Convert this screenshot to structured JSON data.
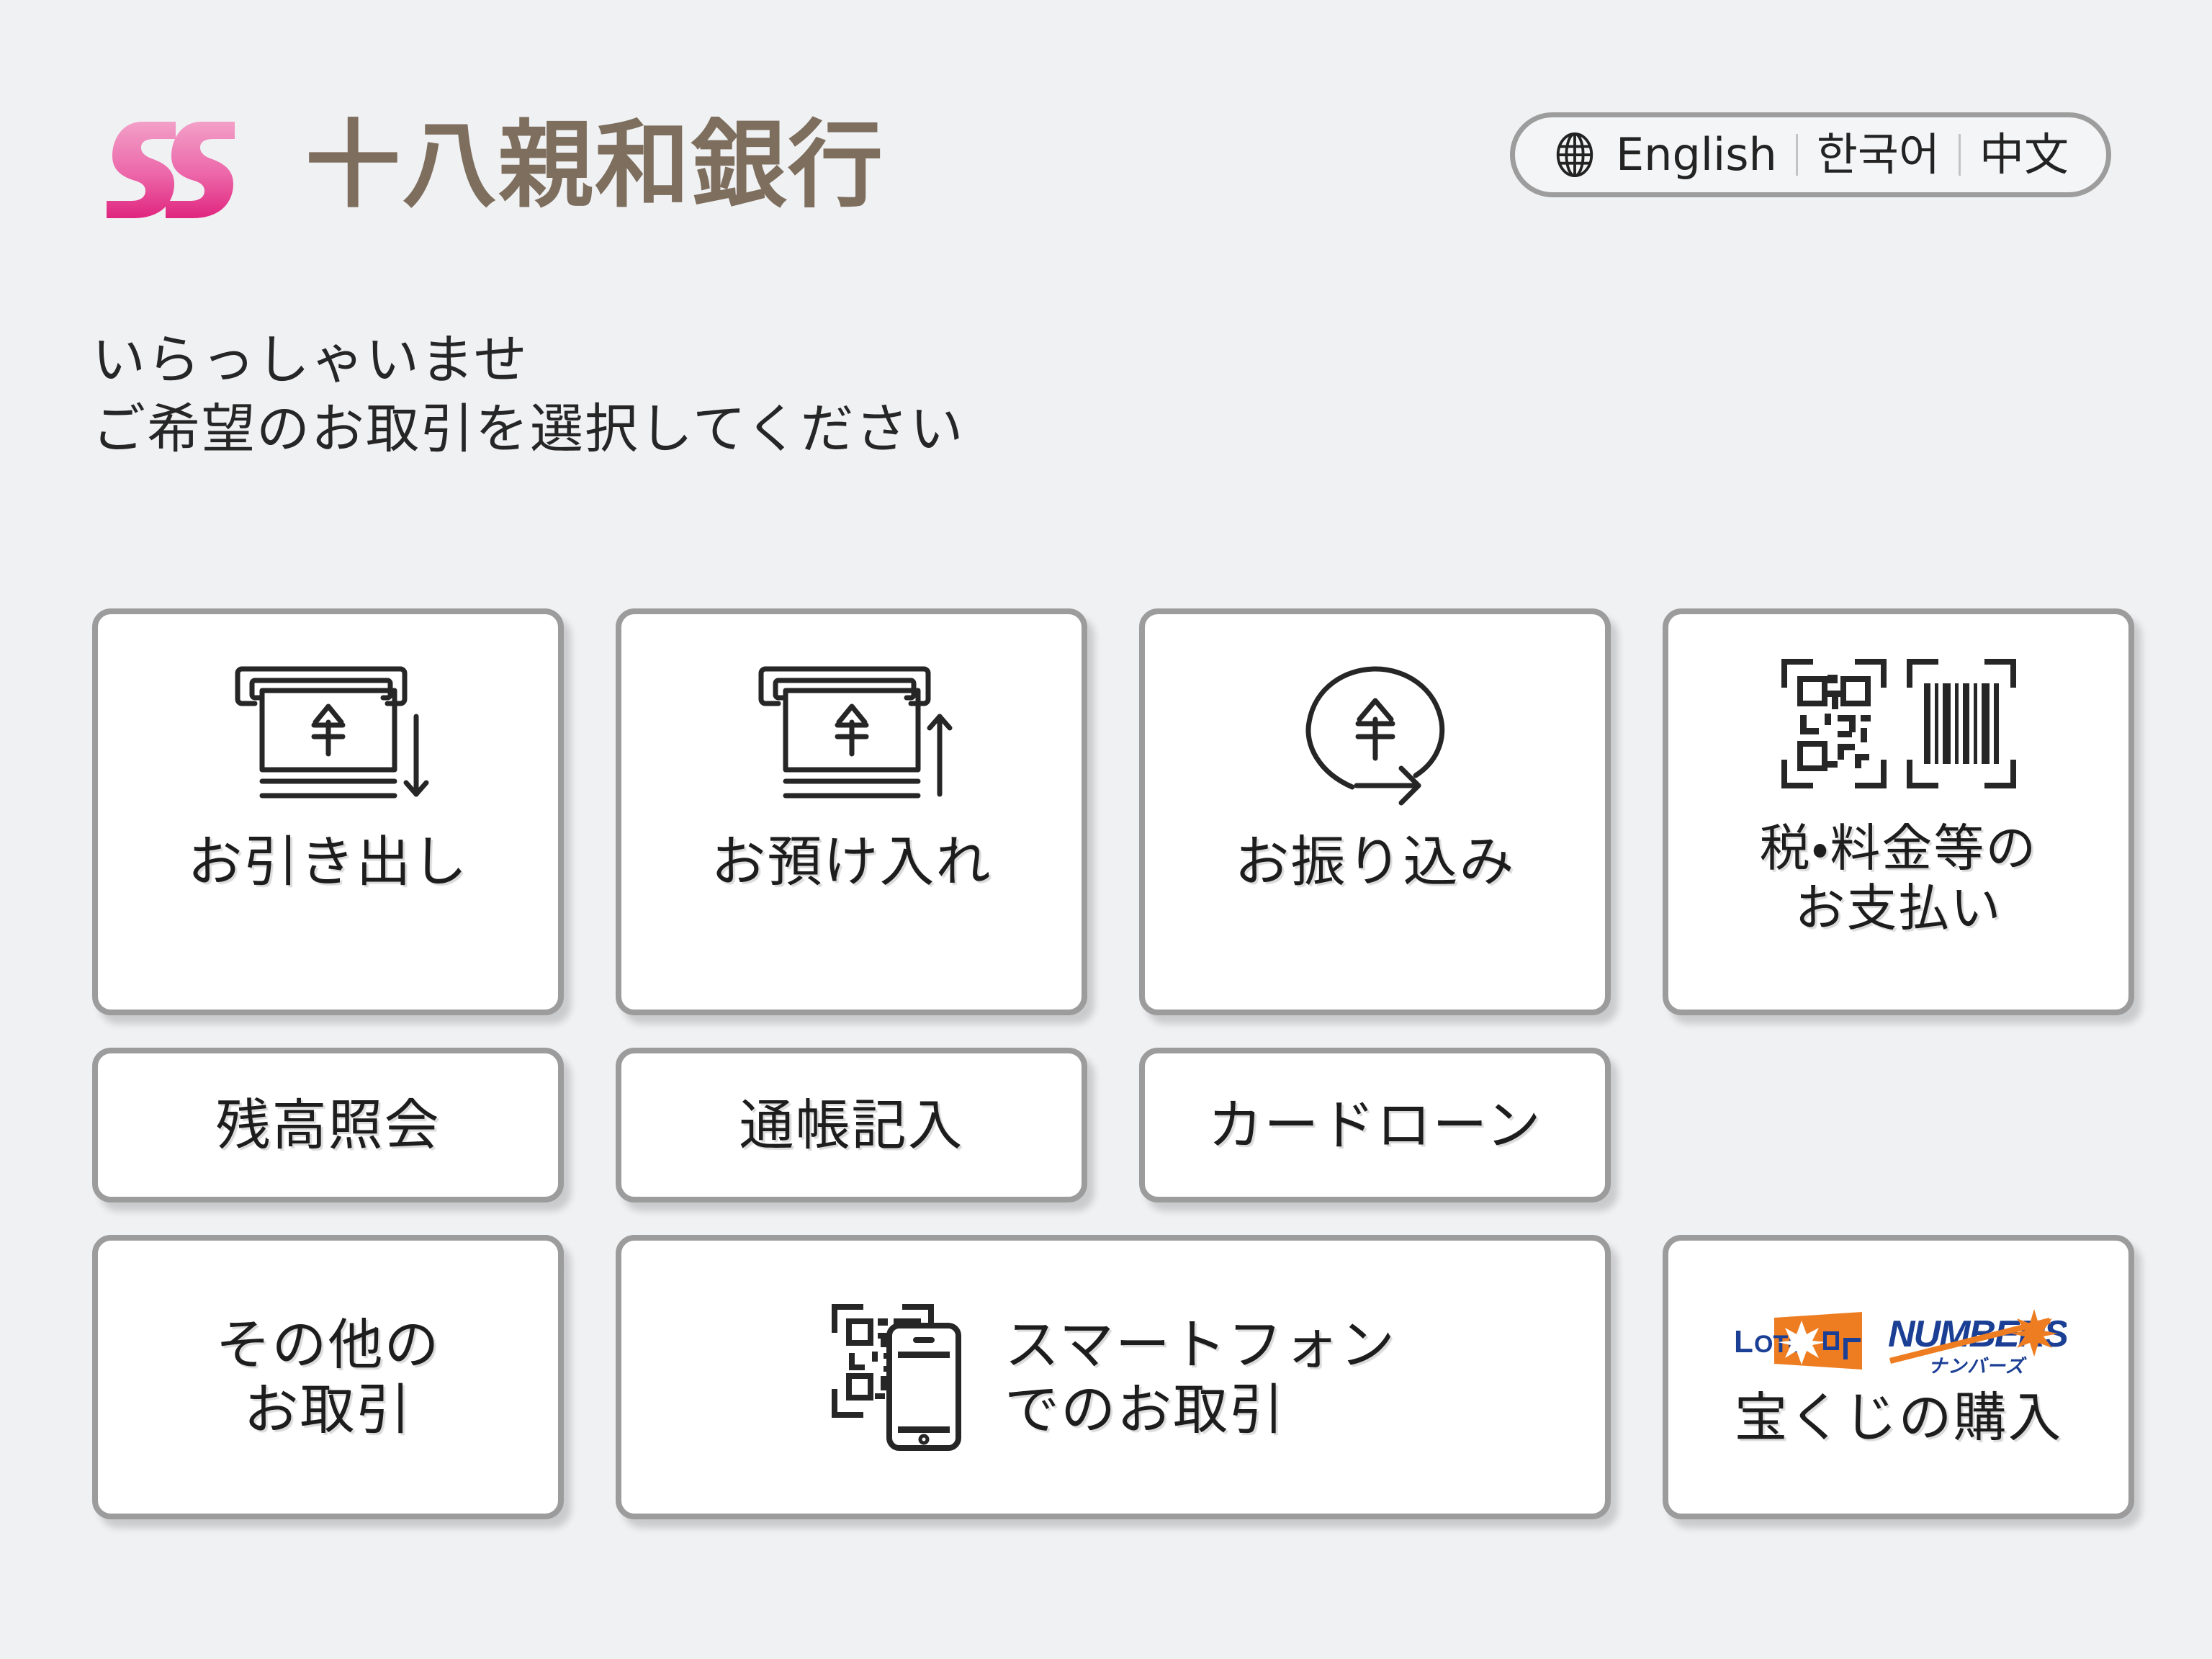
{
  "bank": {
    "name": "十八親和銀行",
    "logo_mark_name": "ss-pink-mark",
    "brand_color": "#7d6e5d",
    "mark_color_light": "#ef8fc0",
    "mark_color_dark": "#e0308b"
  },
  "language_switcher": {
    "globe_icon": "globe-icon",
    "options": [
      {
        "label": "English"
      },
      {
        "label": "한국어"
      },
      {
        "label": "中文"
      }
    ]
  },
  "greeting": {
    "line1": "いらっしゃいませ",
    "line2": "ご希望のお取引を選択してください"
  },
  "menu": {
    "row1": [
      {
        "label": "お引き出し",
        "icon": "atm-cash-withdraw-icon"
      },
      {
        "label": "お預け入れ",
        "icon": "atm-cash-deposit-icon"
      },
      {
        "label": "お振り込み",
        "icon": "yen-transfer-arrow-icon"
      },
      {
        "label": "税・料金等の\nお支払い",
        "icon": "qr-barcode-scan-icon"
      }
    ],
    "row2": [
      {
        "label": "残高照会"
      },
      {
        "label": "通帳記入"
      },
      {
        "label": "カードローン"
      }
    ],
    "row3": [
      {
        "label": "その他の\nお取引"
      },
      {
        "label": "スマートフォン\nでのお取引",
        "icon": "qr-smartphone-icon"
      },
      {
        "label": "宝くじの購入",
        "icon": "lottery-logos"
      }
    ]
  },
  "lottery": {
    "loto_text": "LOTO",
    "loto_kana": "ロト",
    "numbers_text": "NUMBERS",
    "numbers_kana": "ナンバーズ",
    "brand_blue": "#1b3f94",
    "brand_orange": "#ee7d22"
  },
  "colors": {
    "background": "#f0f1f3",
    "button_border": "#9c9c9c",
    "button_fill": "#ffffff",
    "text": "#1d1d1d"
  }
}
